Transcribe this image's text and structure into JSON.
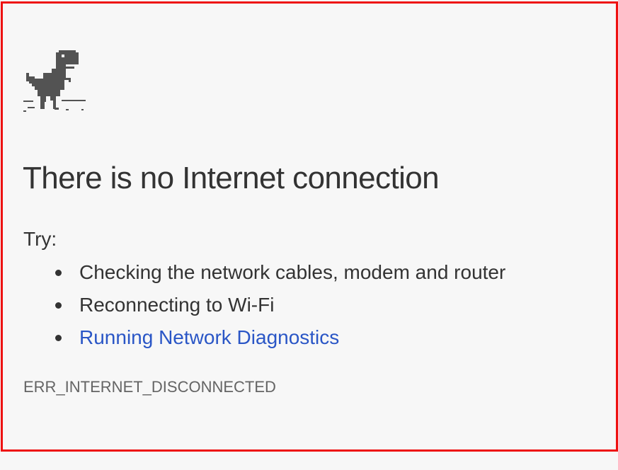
{
  "page": {
    "title": "There is no Internet connection",
    "try_label": "Try:",
    "suggestions": [
      "Checking the network cables, modem and router",
      "Reconnecting to Wi-Fi"
    ],
    "diagnostics_link": "Running Network Diagnostics",
    "error_code": "ERR_INTERNET_DISCONNECTED"
  },
  "icons": {
    "dino": "offline-dinosaur-icon",
    "bullet": "bullet-dot"
  },
  "colors": {
    "background": "#f7f7f7",
    "frame_border": "#ee1111",
    "text": "#333333",
    "link": "#2a56c6",
    "error_code": "#646464",
    "dino": "#535353"
  }
}
